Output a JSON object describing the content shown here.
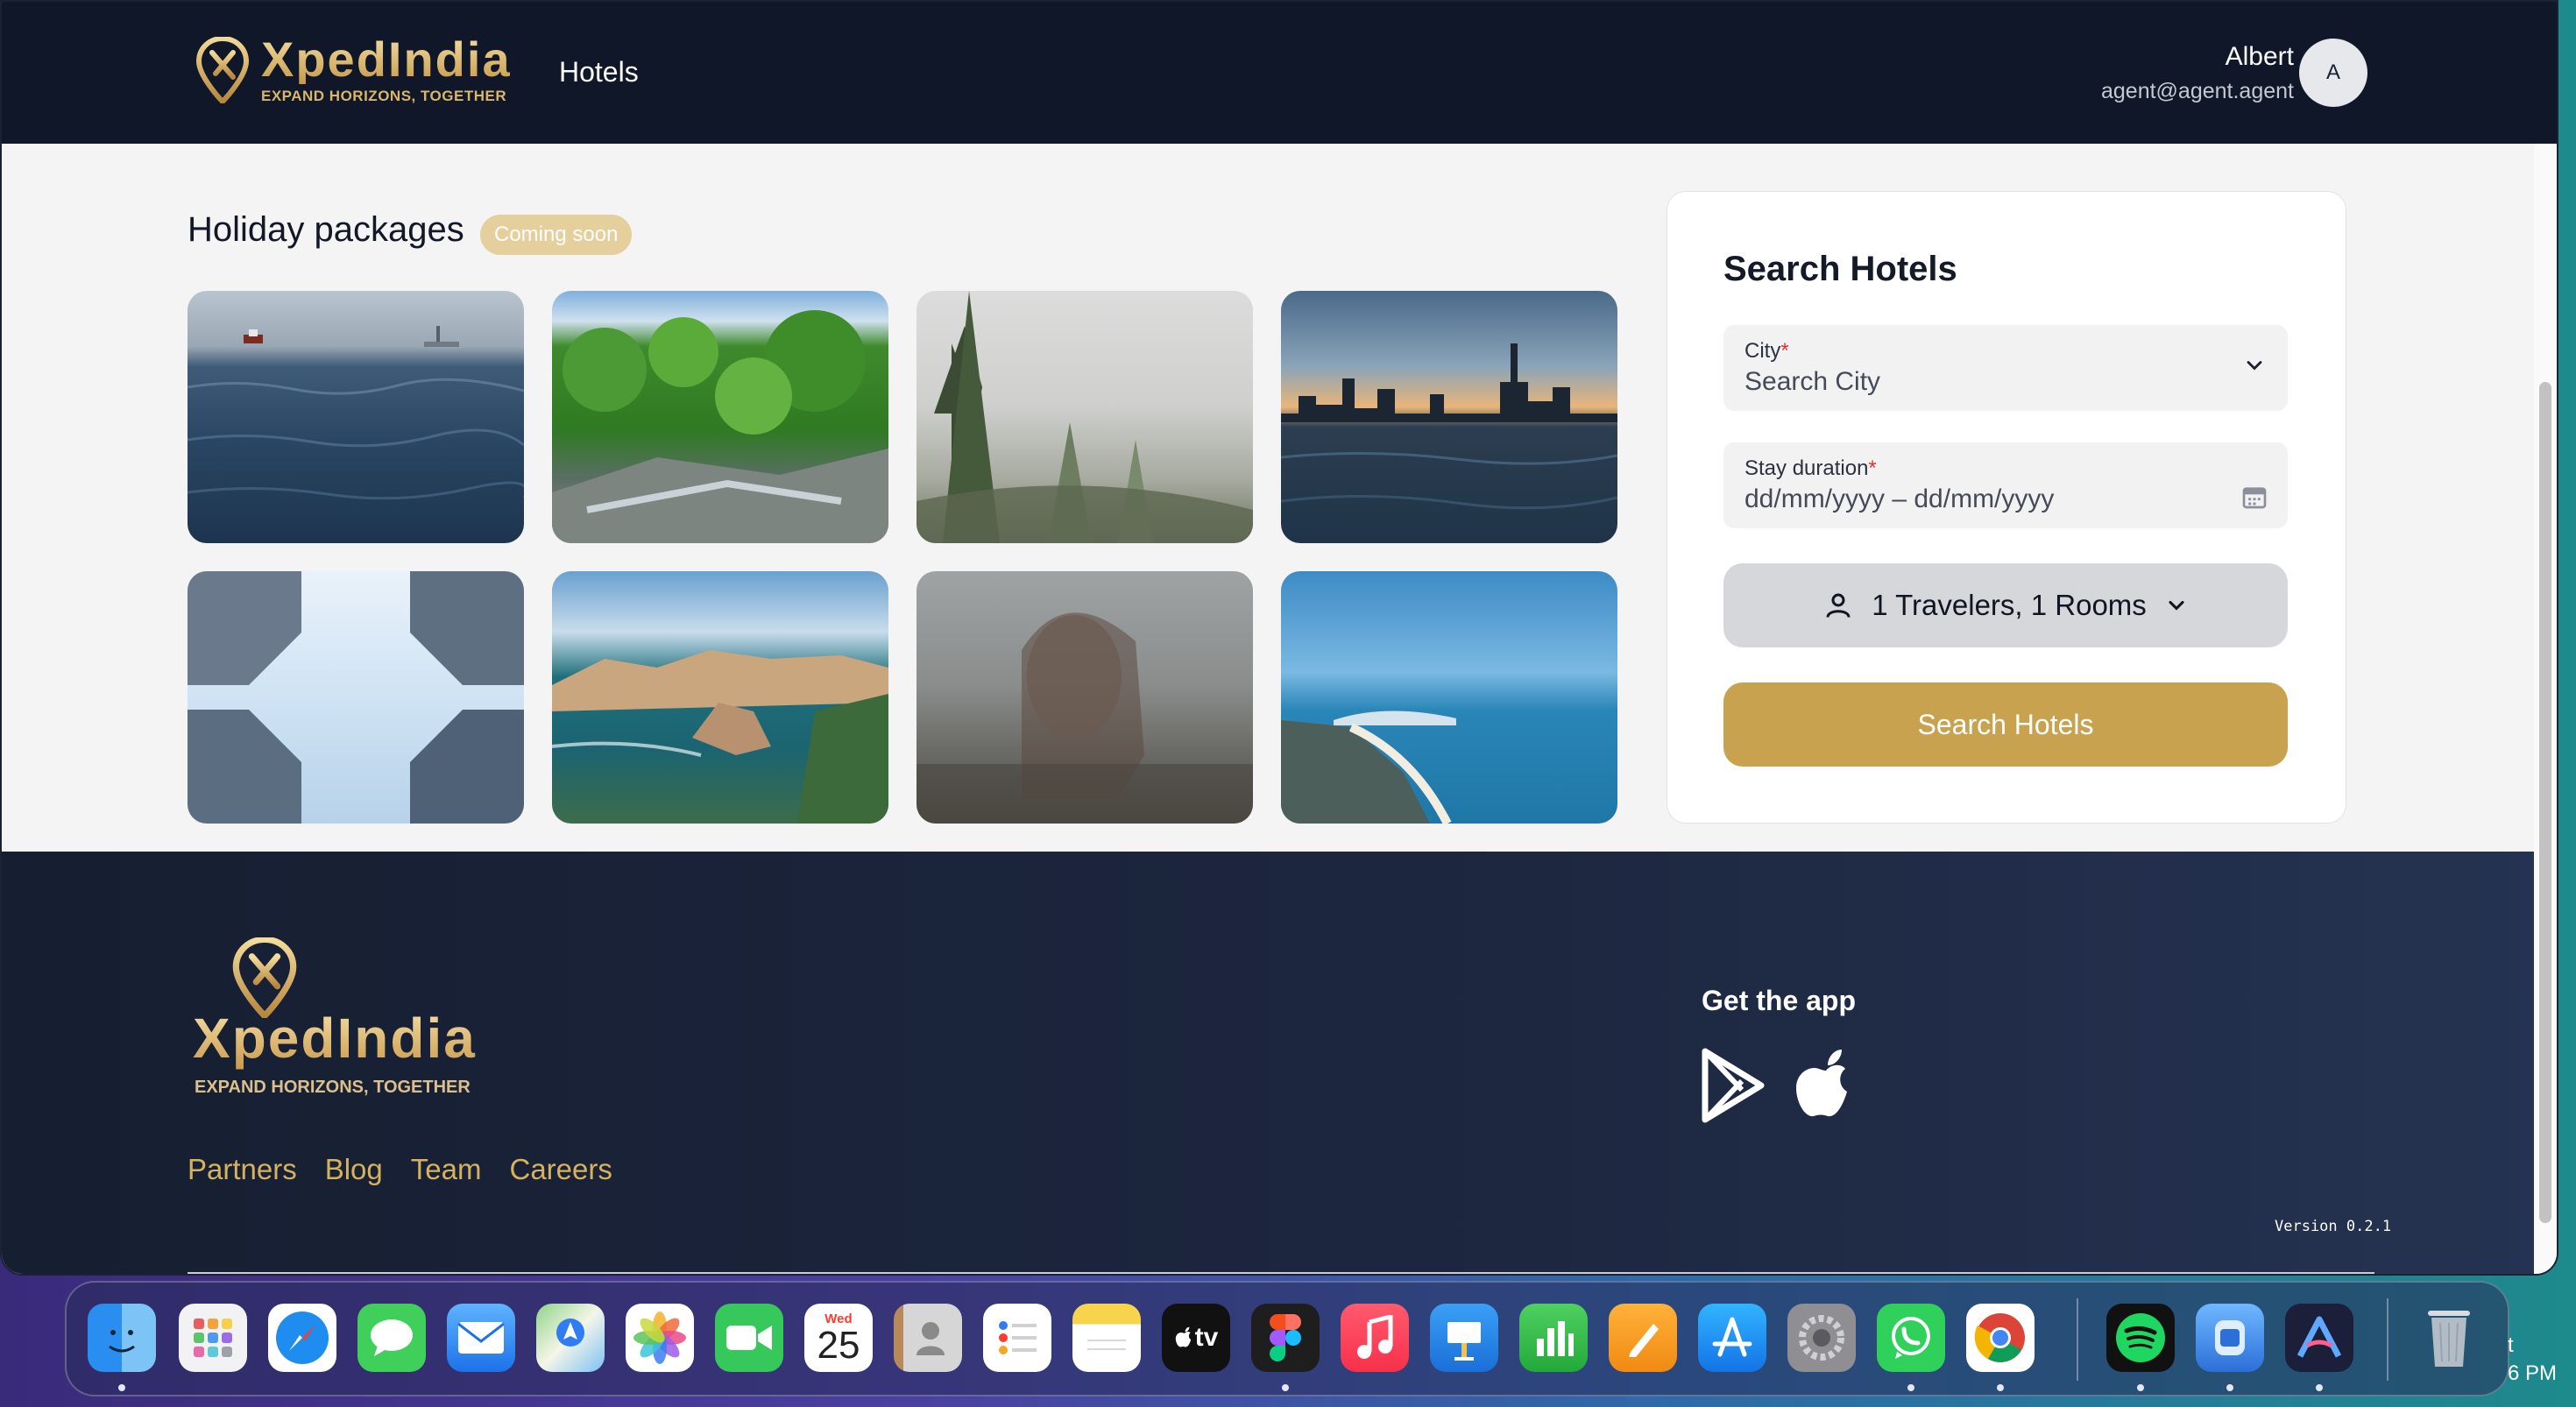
{
  "header": {
    "brand_name": "XpedIndia",
    "brand_tagline": "EXPAND HORIZONS, TOGETHER",
    "nav_hotels": "Hotels",
    "user_name": "Albert",
    "user_email": "agent@agent.agent",
    "avatar_initial": "A"
  },
  "holiday": {
    "title": "Holiday packages",
    "badge": "Coming soon",
    "tiles": [
      "harbor-statue",
      "forest-river",
      "misty-pines",
      "city-skyline-sunset",
      "buildings-sky",
      "coastal-cliffs",
      "woman-rainy-window",
      "beach-coastline"
    ]
  },
  "search": {
    "title": "Search Hotels",
    "city_label": "City",
    "required_mark": "*",
    "city_placeholder": "Search City",
    "stay_label": "Stay duration",
    "stay_placeholder": "dd/mm/yyyy – dd/mm/yyyy",
    "travelers": "1 Travelers, 1 Rooms",
    "button": "Search Hotels"
  },
  "footer": {
    "brand_name": "XpedIndia",
    "brand_tagline": "EXPAND HORIZONS, TOGETHER",
    "links": [
      "Partners",
      "Blog",
      "Team",
      "Careers"
    ],
    "get_app": "Get the app",
    "version_label": "Version",
    "version_number": "0.2.1"
  },
  "dock": {
    "calendar_day": "Wed",
    "calendar_date": "25",
    "tv_label": "tv",
    "clock_fragment": "t",
    "clock_time": "6 PM",
    "apps": [
      "finder",
      "launchpad",
      "safari",
      "messages",
      "mail",
      "maps",
      "photos",
      "facetime",
      "calendar",
      "contacts",
      "reminders",
      "notes",
      "apple-tv",
      "figma",
      "music",
      "keynote",
      "numbers",
      "pages",
      "app-store",
      "system-settings",
      "whatsapp",
      "chrome",
      "spotify",
      "migration",
      "arc",
      "trash"
    ]
  },
  "colors": {
    "header_bg": "#0f1729",
    "accent_gold": "#c8a24e",
    "footer_link": "#d6b25f"
  }
}
